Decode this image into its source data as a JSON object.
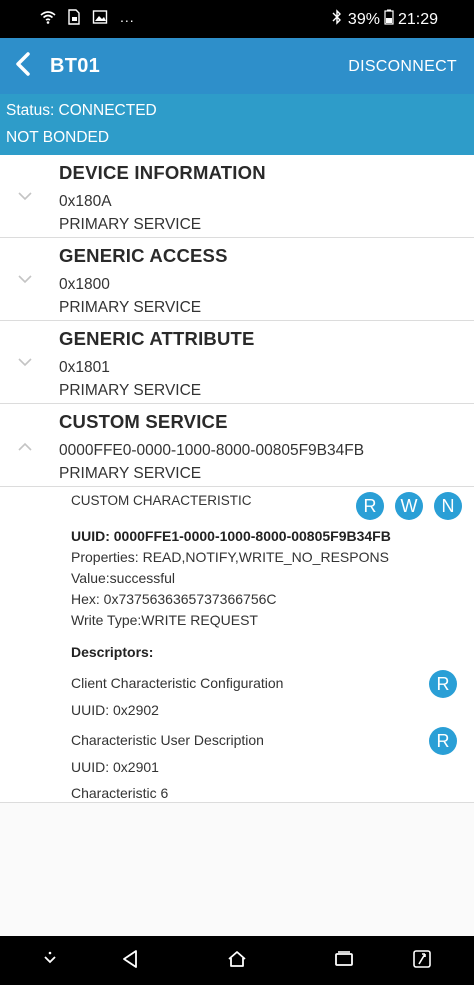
{
  "statusbar": {
    "icons": [
      "wifi-icon",
      "sim-card-icon",
      "image-icon"
    ],
    "more": "...",
    "bluetooth_icon": "bluetooth-icon",
    "battery": "39%",
    "battery_icon": "battery-charging-icon",
    "time": "21:29"
  },
  "appbar": {
    "title": "BT01",
    "back_icon": "back-arrow-icon",
    "disconnect_label": "DISCONNECT",
    "color": "#2e8fca"
  },
  "connection": {
    "status": "Status: CONNECTED",
    "bond": "NOT BONDED",
    "color": "#2e9cc9"
  },
  "services": [
    {
      "name": "DEVICE INFORMATION",
      "uuid": "0x180A",
      "type": "PRIMARY SERVICE",
      "expanded": false
    },
    {
      "name": "GENERIC ACCESS",
      "uuid": "0x1800",
      "type": "PRIMARY SERVICE",
      "expanded": false
    },
    {
      "name": "GENERIC ATTRIBUTE",
      "uuid": "0x1801",
      "type": "PRIMARY SERVICE",
      "expanded": false
    },
    {
      "name": "CUSTOM SERVICE",
      "uuid": "0000FFE0-0000-1000-8000-00805F9B34FB",
      "type": "PRIMARY SERVICE",
      "expanded": true
    }
  ],
  "characteristic": {
    "name": "CUSTOM CHARACTERISTIC",
    "uuid": "UUID: 0000FFE1-0000-1000-8000-00805F9B34FB",
    "properties": "Properties: READ,NOTIFY,WRITE_NO_RESPONS",
    "value": "Value:successful",
    "hex": "Hex: 0x7375636365737366756C",
    "write_type": "Write Type:WRITE REQUEST",
    "buttons": {
      "read": "R",
      "write": "W",
      "notify": "N"
    },
    "descriptors_header": "Descriptors:",
    "descriptors": [
      {
        "name": "Client Characteristic Configuration",
        "uuid": "UUID: 0x2902",
        "button": "R"
      },
      {
        "name": "Characteristic User Description",
        "uuid": "UUID: 0x2901",
        "button": "R"
      }
    ],
    "user_description_value": "Characteristic 6",
    "accent_color": "#2a9fd6"
  },
  "navbar": {
    "icons": [
      "navbar-toggle-icon",
      "back-triangle-icon",
      "home-icon",
      "recents-icon",
      "screen-rotate-icon"
    ]
  }
}
